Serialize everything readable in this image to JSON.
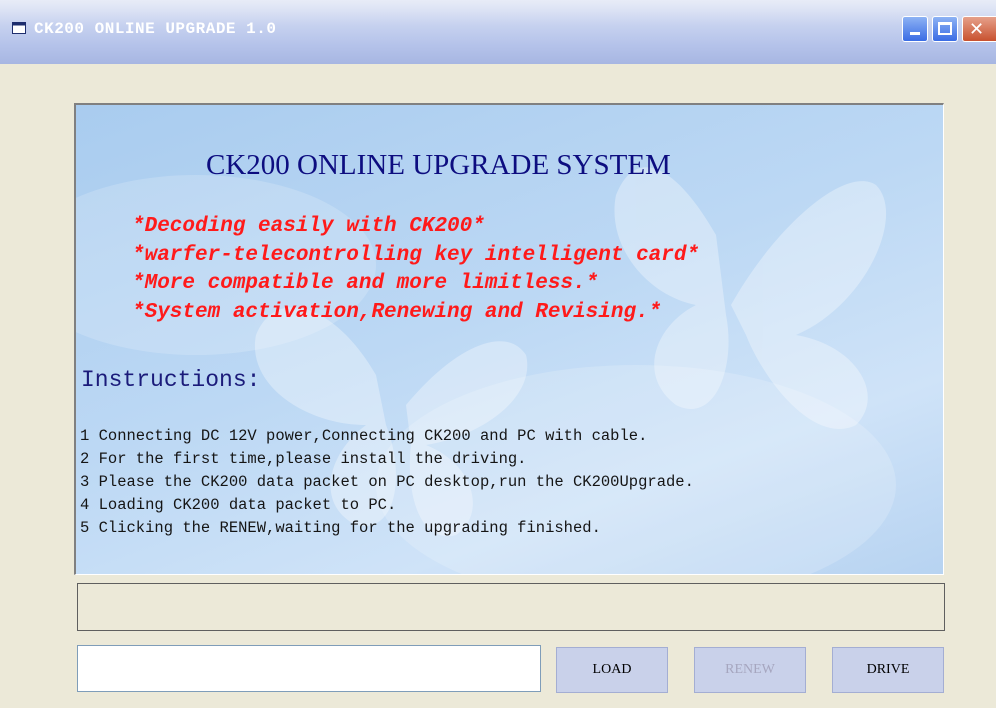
{
  "window": {
    "title": "CK200 ONLINE UPGRADE 1.0",
    "icon": "app-window-icon",
    "controls": {
      "minimize": "minimize-icon",
      "maximize": "maximize-icon",
      "close": "close-icon"
    }
  },
  "panel": {
    "heading": "CK200 ONLINE UPGRADE SYSTEM",
    "features": [
      "*Decoding easily with CK200*",
      "*warfer-telecontrolling key intelligent card*",
      "*More compatible and more limitless.*",
      "*System activation,Renewing and Revising.*"
    ],
    "instructions_title": "Instructions:",
    "instructions": [
      "1 Connecting DC 12V power,Connecting CK200 and PC with cable.",
      "2 For the first time,please install the driving.",
      "3 Please the CK200 data packet on PC desktop,run the CK200Upgrade.",
      "4 Loading CK200 data packet to PC.",
      "5 Clicking the RENEW,waiting for the upgrading finished."
    ]
  },
  "status": {
    "text": ""
  },
  "file_path": {
    "value": ""
  },
  "buttons": {
    "load": "LOAD",
    "renew": "RENEW",
    "drive": "DRIVE"
  },
  "colors": {
    "title_bar": "#b5c3ea",
    "panel_background": "#bcd8f4",
    "heading": "#0d0d80",
    "feature_text": "#ff1a1a",
    "disabled_button_text": "#a6a6bf"
  }
}
